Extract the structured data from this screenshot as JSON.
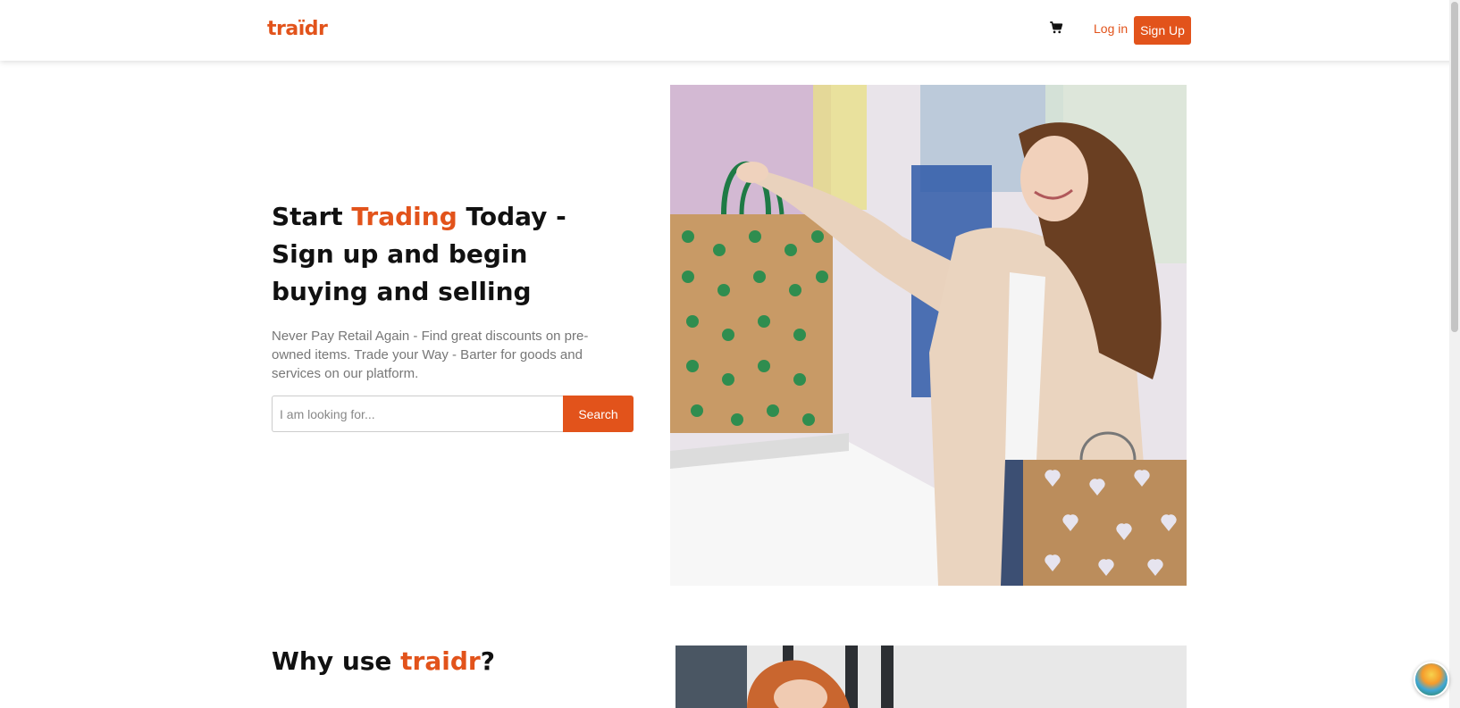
{
  "header": {
    "logo": "traïdr",
    "cart_icon": "cart-icon",
    "login": "Log in",
    "signup": "Sign Up"
  },
  "hero": {
    "title_prefix": "Start ",
    "title_accent": "Trading",
    "title_suffix": " Today - Sign up and begin buying and selling",
    "subtitle": "Never Pay Retail Again - Find great discounts on pre-owned items. Trade your Way - Barter for goods and services on our platform.",
    "search": {
      "placeholder": "I am looking for...",
      "value": "",
      "button": "Search"
    }
  },
  "why": {
    "prefix": "Why use ",
    "accent": "traidr",
    "suffix": "?"
  },
  "colors": {
    "accent": "#e2531b"
  }
}
